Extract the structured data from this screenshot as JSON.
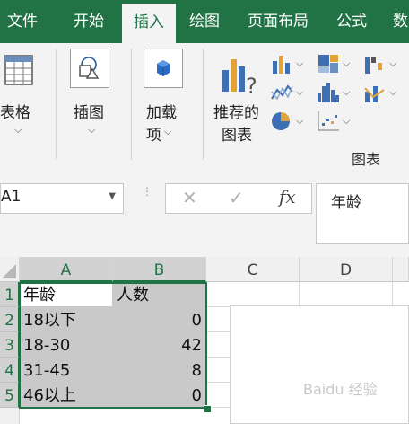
{
  "tabs": [
    "文件",
    "开始",
    "插入",
    "绘图",
    "页面布局",
    "公式",
    "数"
  ],
  "active_tab": "插入",
  "ribbon": {
    "table_label": "表格",
    "illustrations_label": "插图",
    "addins_line1": "加载",
    "addins_line2": "项",
    "recommended_line1": "推荐的",
    "recommended_line2": "图表",
    "charts_group_label": "图表"
  },
  "name_box": "A1",
  "formula_content": "年龄",
  "columns": [
    "A",
    "B",
    "C",
    "D"
  ],
  "rows": [
    "1",
    "2",
    "3",
    "4",
    "5"
  ],
  "cells": [
    {
      "a": "年龄",
      "b": "人数"
    },
    {
      "a": "18以下",
      "b": "0"
    },
    {
      "a": "18-30",
      "b": "42"
    },
    {
      "a": "31-45",
      "b": "8"
    },
    {
      "a": "46以上",
      "b": "0"
    }
  ],
  "watermark": "Baidu 经验",
  "colors": {
    "brand_green": "#217346",
    "selection_fill": "#c9c9c9",
    "ribbon_bg": "#f3f3f3"
  }
}
